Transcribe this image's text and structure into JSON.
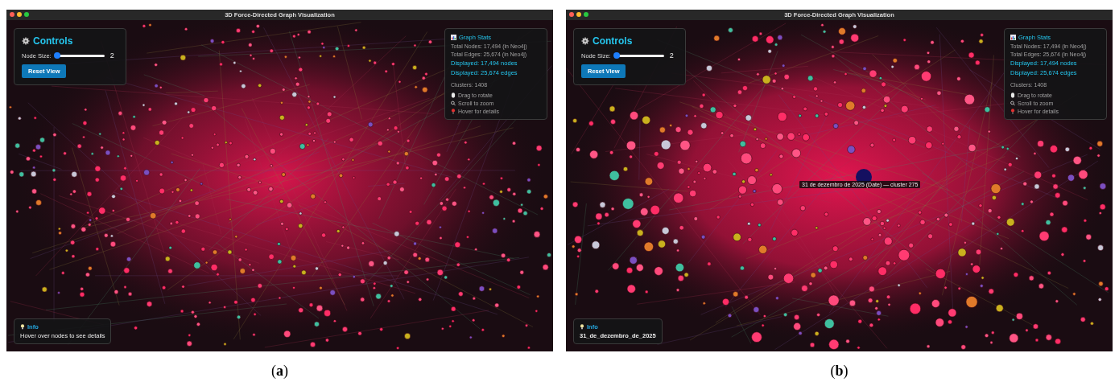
{
  "figures": [
    {
      "caption": "(**a**)",
      "window": {
        "title": "3D Force-Directed Graph Visualization"
      },
      "controls": {
        "title": "Controls",
        "node_size": {
          "label": "Node Size:",
          "level": 0.02,
          "value": "2"
        },
        "reset_button": "Reset View"
      },
      "stats": {
        "title": "Graph Stats",
        "lines": [
          {
            "kind": "total",
            "text": "Total Nodes: 17,494 (in Neo4j)"
          },
          {
            "kind": "total",
            "text": "Total Edges: 25,674 (in Neo4j)"
          },
          {
            "kind": "displayed",
            "text": "Displayed: 17,494 nodes"
          },
          {
            "kind": "displayed",
            "text": "Displayed: 25,674 edges"
          },
          {
            "kind": "clusters",
            "text": "Clusters: 1408"
          }
        ],
        "hints": [
          {
            "kind": "drag",
            "text": "Drag to rotate"
          },
          {
            "kind": "scroll",
            "text": "Scroll to zoom"
          },
          {
            "kind": "hover",
            "text": "Hover for details"
          }
        ]
      },
      "info": {
        "title": "Info",
        "kind": "hint",
        "text": "Hover over nodes to see details"
      }
    },
    {
      "caption": "(**b**)",
      "window": {
        "title": "3D Force-Directed Graph Visualization"
      },
      "controls": {
        "title": "Controls",
        "node_size": {
          "label": "Node Size:",
          "level": 0.02,
          "value": "2"
        },
        "reset_button": "Reset View"
      },
      "stats": {
        "title": "Graph Stats",
        "lines": [
          {
            "kind": "total",
            "text": "Total Nodes: 17,494 (in Neo4j)"
          },
          {
            "kind": "total",
            "text": "Total Edges: 25,674 (in Neo4j)"
          },
          {
            "kind": "displayed",
            "text": "Displayed: 17,494 nodes"
          },
          {
            "kind": "displayed",
            "text": "Displayed: 25,674 edges"
          },
          {
            "kind": "clusters",
            "text": "Clusters: 1408"
          }
        ],
        "hints": [
          {
            "kind": "drag",
            "text": "Drag to rotate"
          },
          {
            "kind": "scroll",
            "text": "Scroll to zoom"
          },
          {
            "kind": "hover",
            "text": "Hover for details"
          }
        ]
      },
      "info": {
        "title": "Info",
        "kind": "selection",
        "text": "31_de_dezembro_de_2025"
      },
      "tooltip": {
        "text": "31 de dezembro de 2025 (Date) — cluster 275"
      }
    }
  ]
}
